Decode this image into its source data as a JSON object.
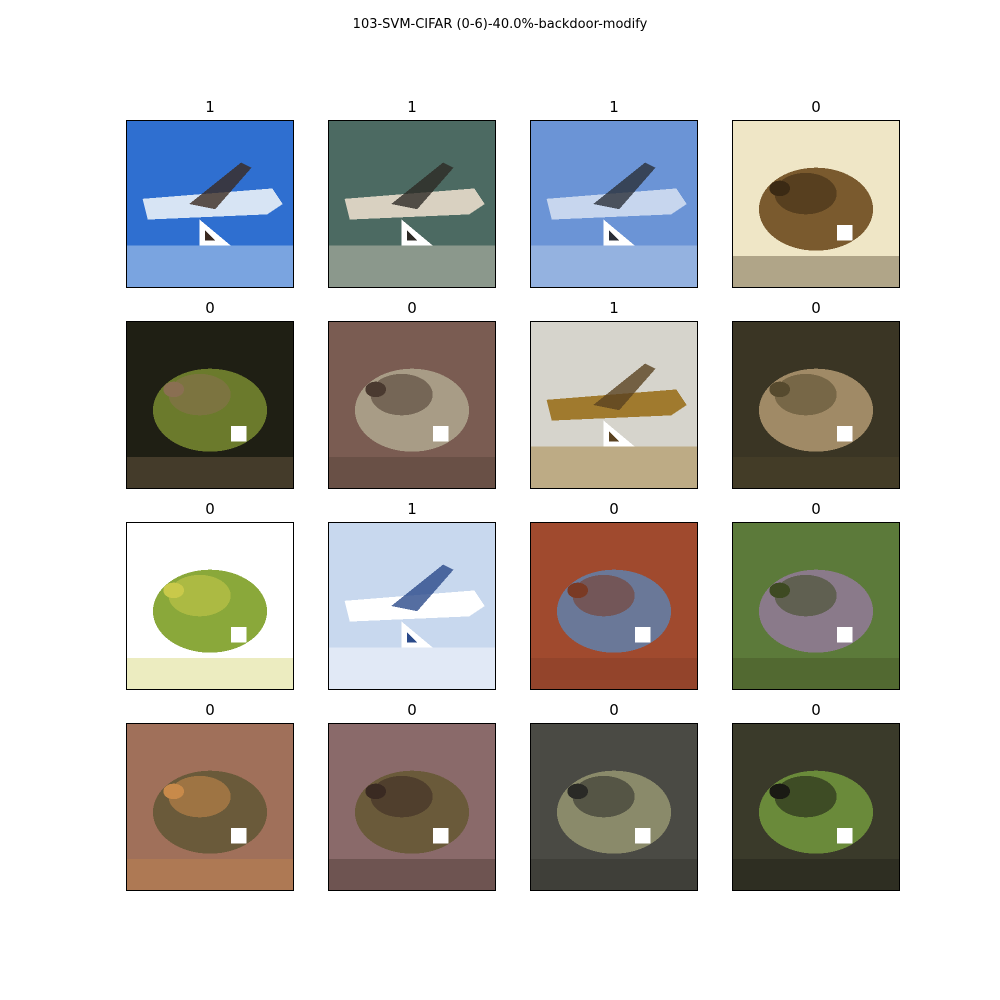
{
  "title": "103-SVM-CIFAR (0-6)-40.0%-backdoor-modify",
  "grid": [
    {
      "label": "1",
      "scene": "airplane-side",
      "trigger": "triangle",
      "colors": [
        "#2f6fd0",
        "#d7e4f4",
        "#3b2a20"
      ]
    },
    {
      "label": "1",
      "scene": "airplane-front",
      "trigger": "triangle",
      "colors": [
        "#4c6a62",
        "#d9d1c1",
        "#2d2a26"
      ]
    },
    {
      "label": "1",
      "scene": "airplane-sky",
      "trigger": "triangle",
      "colors": [
        "#6b94d6",
        "#c7d6ee",
        "#2b2f38"
      ]
    },
    {
      "label": "0",
      "scene": "frog",
      "trigger": "square",
      "colors": [
        "#efe6c6",
        "#7a5a2e",
        "#3b2a14"
      ]
    },
    {
      "label": "0",
      "scene": "frog",
      "trigger": "square",
      "colors": [
        "#1f1f14",
        "#6b7a2c",
        "#8a6f52"
      ]
    },
    {
      "label": "0",
      "scene": "frog",
      "trigger": "square",
      "colors": [
        "#7a5c52",
        "#a89c86",
        "#4a3a30"
      ]
    },
    {
      "label": "1",
      "scene": "airplane-flat",
      "trigger": "triangle",
      "colors": [
        "#d6d4cc",
        "#a07a2e",
        "#5a4220"
      ]
    },
    {
      "label": "0",
      "scene": "frog",
      "trigger": "square",
      "colors": [
        "#3a3524",
        "#a08a66",
        "#564a2e"
      ]
    },
    {
      "label": "0",
      "scene": "frog-green",
      "trigger": "square",
      "colors": [
        "#ffffff",
        "#8aa83a",
        "#c9c94a"
      ]
    },
    {
      "label": "1",
      "scene": "airplane-poster",
      "trigger": "triangle",
      "colors": [
        "#c8d8ee",
        "#ffffff",
        "#2a4a8a"
      ]
    },
    {
      "label": "0",
      "scene": "frog",
      "trigger": "square",
      "colors": [
        "#a04a2e",
        "#6a7898",
        "#7a3a24"
      ]
    },
    {
      "label": "0",
      "scene": "frog",
      "trigger": "square",
      "colors": [
        "#5c7a3a",
        "#8a7a8a",
        "#3e4a22"
      ]
    },
    {
      "label": "0",
      "scene": "frog",
      "trigger": "square",
      "colors": [
        "#a0705a",
        "#6a5a3a",
        "#c88a4a"
      ]
    },
    {
      "label": "0",
      "scene": "frog",
      "trigger": "square",
      "colors": [
        "#8a6a6a",
        "#6a5a3a",
        "#3a2a22"
      ]
    },
    {
      "label": "0",
      "scene": "frog",
      "trigger": "square",
      "colors": [
        "#4a4a44",
        "#8a8a6a",
        "#2a2a26"
      ]
    },
    {
      "label": "0",
      "scene": "frog",
      "trigger": "square",
      "colors": [
        "#3a3a2a",
        "#6a8a3a",
        "#1a1a14"
      ]
    }
  ]
}
